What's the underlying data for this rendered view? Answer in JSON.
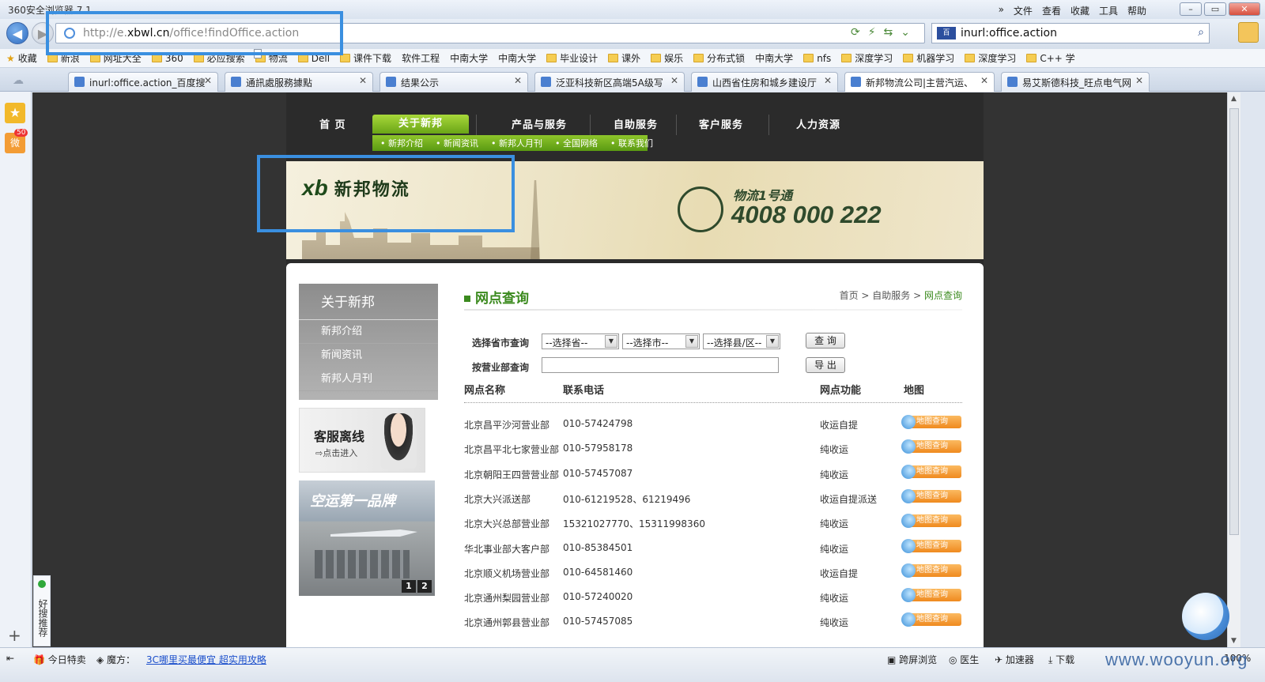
{
  "window": {
    "app_title": "360安全浏览器 7.1",
    "menu": [
      "»",
      "文件",
      "查看",
      "收藏",
      "工具",
      "帮助"
    ]
  },
  "address_bar": {
    "url_prefix": "http://e.",
    "url_domain": "xbwl.cn",
    "url_path": "/office!findOffice.action",
    "search_query": "inurl:office.action"
  },
  "bookmarks": [
    {
      "label": "收藏",
      "icon": "star-icon"
    },
    {
      "label": "新浪",
      "icon": "folder-icon"
    },
    {
      "label": "网址大全",
      "icon": "folder-icon"
    },
    {
      "label": "360",
      "icon": "folder-icon"
    },
    {
      "label": "必应搜索",
      "icon": "folder-icon"
    },
    {
      "label": "物流",
      "icon": "folder-icon"
    },
    {
      "label": "Dell",
      "icon": "folder-icon"
    },
    {
      "label": "课件下载",
      "icon": "folder-icon"
    },
    {
      "label": "软件工程",
      "icon": "page-icon"
    },
    {
      "label": "中南大学",
      "icon": "page-icon"
    },
    {
      "label": "中南大学",
      "icon": "page-icon"
    },
    {
      "label": "毕业设计",
      "icon": "folder-icon"
    },
    {
      "label": "课外",
      "icon": "folder-icon"
    },
    {
      "label": "娱乐",
      "icon": "folder-icon"
    },
    {
      "label": "分布式锁",
      "icon": "folder-icon"
    },
    {
      "label": "中南大学",
      "icon": "page-icon"
    },
    {
      "label": "nfs",
      "icon": "folder-icon"
    },
    {
      "label": "深度学习",
      "icon": "folder-icon"
    },
    {
      "label": "机器学习",
      "icon": "folder-icon"
    },
    {
      "label": "深度学习",
      "icon": "folder-icon"
    },
    {
      "label": "C++ 学",
      "icon": "folder-icon"
    }
  ],
  "tabs": [
    {
      "label": "inurl:office.action_百度搜",
      "active": false
    },
    {
      "label": "通訊處服務據點",
      "active": false
    },
    {
      "label": "结果公示",
      "active": false
    },
    {
      "label": "泛亚科技新区高端5A级写",
      "active": false
    },
    {
      "label": "山西省住房和城乡建设厅",
      "active": false
    },
    {
      "label": "新邦物流公司|主营汽运、",
      "active": true
    },
    {
      "label": "易艾斯德科技_旺点电气网",
      "active": false
    }
  ],
  "sidebar": {
    "weibo_badge": "50",
    "haosou": "好搜推荐"
  },
  "site": {
    "nav": [
      "首 页",
      "关于新邦",
      "产品与服务",
      "自助服务",
      "客户服务",
      "人力资源"
    ],
    "subnav": [
      "新邦介绍",
      "新闻资讯",
      "新邦人月刊",
      "全国网络",
      "联系我们"
    ],
    "logo_mark": "xb",
    "logo_name": "新邦物流",
    "slogan_small": "物流1号通",
    "hotline": "4008 000 222",
    "side_menu": {
      "header": "关于新邦",
      "items": [
        "新邦介绍",
        "新闻资讯",
        "新邦人月刊"
      ]
    },
    "cs_promo": {
      "title": "客服离线",
      "sub": "点击进入"
    },
    "air_promo": {
      "title": "空运第一品牌",
      "pages": [
        "1",
        "2"
      ]
    },
    "section_title": "网点查询",
    "breadcrumb": [
      "首页",
      "自助服务",
      "网点查询"
    ],
    "form": {
      "province_label": "选择省市查询",
      "province": "--选择省--",
      "city": "--选择市--",
      "county": "--选择县/区--",
      "query_btn": "查 询",
      "dept_label": "按营业部查询",
      "export_btn": "导 出"
    },
    "table_headers": [
      "网点名称",
      "联系电话",
      "网点功能",
      "地图"
    ],
    "map_btn": "地图查询",
    "rows": [
      {
        "name": "北京昌平沙河营业部",
        "phone": "010-57424798",
        "func": "收运自提"
      },
      {
        "name": "北京昌平北七家营业部",
        "phone": "010-57958178",
        "func": "纯收运"
      },
      {
        "name": "北京朝阳王四营营业部",
        "phone": "010-57457087",
        "func": "纯收运"
      },
      {
        "name": "北京大兴派送部",
        "phone": "010-61219528、61219496",
        "func": "收运自提派送"
      },
      {
        "name": "北京大兴总部营业部",
        "phone": "15321027770、15311998360",
        "func": "纯收运"
      },
      {
        "name": "华北事业部大客户部",
        "phone": "010-85384501",
        "func": "纯收运"
      },
      {
        "name": "北京顺义机场营业部",
        "phone": "010-64581460",
        "func": "收运自提"
      },
      {
        "name": "北京通州梨园营业部",
        "phone": "010-57240020",
        "func": "纯收运"
      },
      {
        "name": "北京通州郭县营业部",
        "phone": "010-57457085",
        "func": "纯收运"
      }
    ]
  },
  "statusbar": {
    "today": "今日特卖",
    "mofang": "魔方：",
    "ad": "3C哪里买最便宜 超实用攻略",
    "right": [
      "跨屏浏览",
      "医生",
      "加速器",
      "下载"
    ],
    "zoom": "100%",
    "watermark": "www.wooyun.org"
  },
  "colors": {
    "brand_green": "#6aa517",
    "highlight_blue": "#3a8fe0",
    "map_orange": "#ef8a1f"
  }
}
